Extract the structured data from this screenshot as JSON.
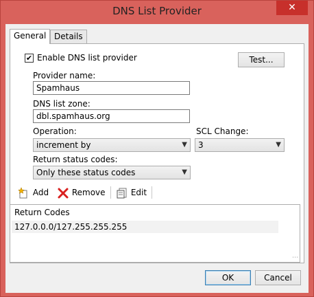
{
  "window": {
    "title": "DNS List Provider",
    "close_glyph": "✕"
  },
  "tabs": [
    {
      "label": "General",
      "active": true
    },
    {
      "label": "Details",
      "active": false
    }
  ],
  "general": {
    "enable_checkbox": {
      "label": "Enable DNS list provider",
      "checked": true,
      "check_glyph": "✔"
    },
    "test_button": "Test...",
    "provider_name": {
      "label": "Provider name:",
      "value": "Spamhaus"
    },
    "dns_list_zone": {
      "label": "DNS list zone:",
      "value": "dbl.spamhaus.org"
    },
    "operation": {
      "label": "Operation:",
      "selected": "increment by"
    },
    "scl_change": {
      "label": "SCL Change:",
      "selected": "3"
    },
    "return_status": {
      "label": "Return status codes:",
      "selected": "Only these status codes"
    }
  },
  "toolbar": {
    "add": "Add",
    "remove": "Remove",
    "edit": "Edit"
  },
  "return_codes": {
    "header": "Return Codes",
    "rows": [
      "127.0.0.0/127.255.255.255"
    ]
  },
  "footer": {
    "ok": "OK",
    "cancel": "Cancel"
  },
  "icons": {
    "add": "add-icon",
    "remove": "remove-icon",
    "edit": "edit-icon",
    "dropdown": "chevron-down-icon"
  }
}
